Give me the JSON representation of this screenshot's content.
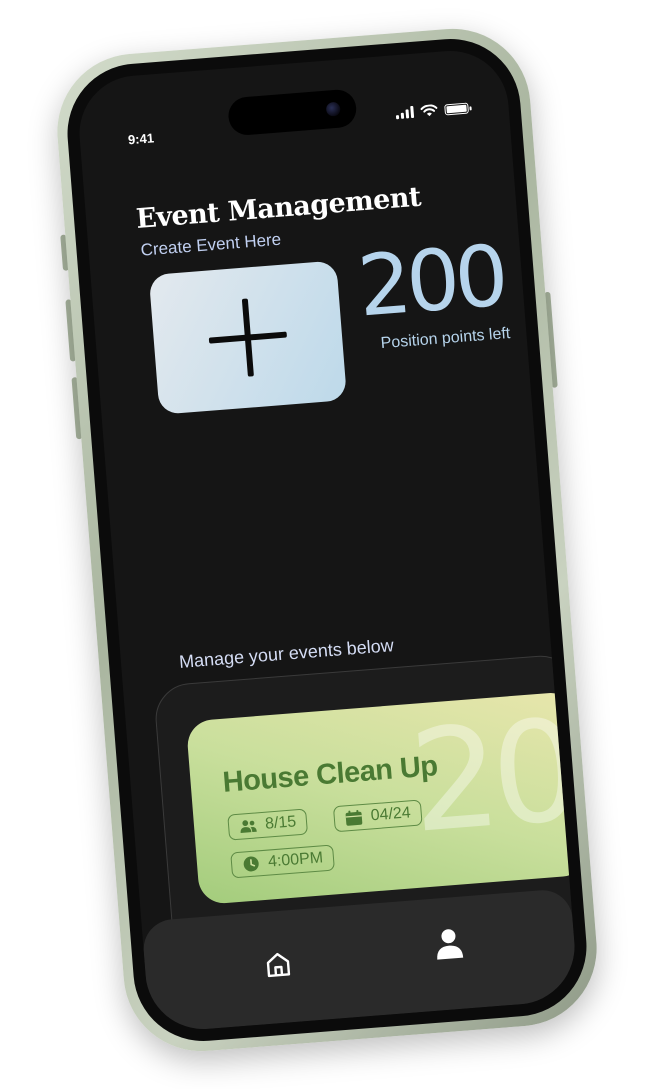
{
  "status_bar": {
    "time": "9:41"
  },
  "header": {
    "title": "Event Management",
    "subtitle": "Create Event Here"
  },
  "create": {
    "icon": "plus-icon"
  },
  "points": {
    "value": "200",
    "label": "Position points left"
  },
  "events_section": {
    "label": "Manage your events below",
    "events": [
      {
        "title": "House Clean Up",
        "watermark": "20",
        "attendees": "8/15",
        "date": "04/24",
        "time": "4:00PM"
      }
    ]
  },
  "nav": {
    "items": [
      {
        "icon": "home-icon"
      },
      {
        "icon": "profile-icon"
      }
    ]
  },
  "colors": {
    "screen_bg": "#151515",
    "accent_blue": "#b6d4ec",
    "card_green": "#c9df9c",
    "card_text": "#4a7a33"
  }
}
